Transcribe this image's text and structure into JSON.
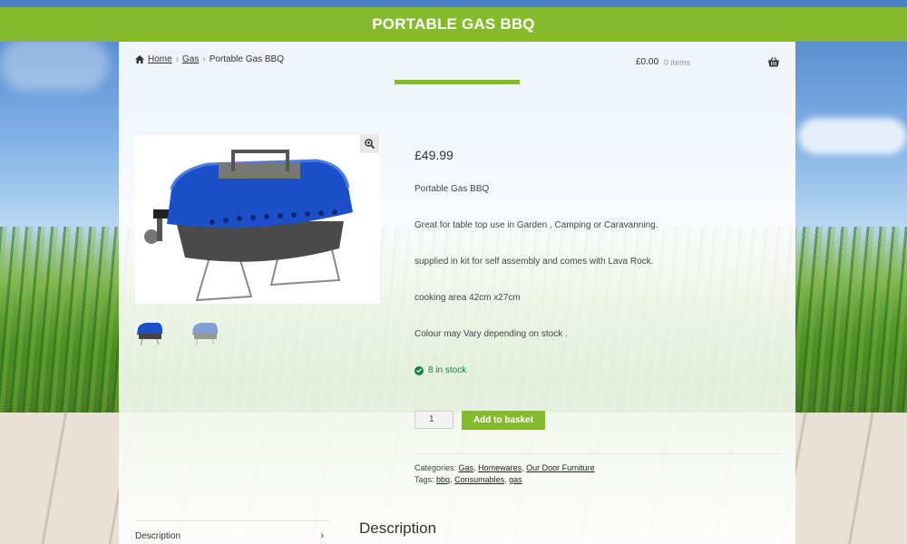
{
  "header": {
    "title": "PORTABLE GAS BBQ"
  },
  "breadcrumb": {
    "home": "Home",
    "category": "Gas",
    "current": "Portable Gas BBQ"
  },
  "cart": {
    "total": "£0.00",
    "count": "0 items"
  },
  "product": {
    "price": "£49.99",
    "description_lines": [
      "Portable Gas BBQ",
      "Great for table top use in Garden , Camping or Caravanning.",
      "supplied in kit for self assembly and comes with Lava Rock.",
      "cooking area 42cm x27cm",
      "Colour may Vary  depending on stock ."
    ],
    "stock": "8 in stock",
    "quantity": "1",
    "add_to_basket": "Add to basket",
    "categories_label": "Categories:",
    "categories": [
      "Gas",
      "Homewares",
      "Our Door Furniture"
    ],
    "tags_label": "Tags:",
    "tags": [
      "bbq",
      "Consumables",
      "gas"
    ]
  },
  "tabs": {
    "description": "Description"
  },
  "section": {
    "heading": "Description"
  },
  "colors": {
    "accent": "#85b92e",
    "stock": "#0f834d"
  }
}
